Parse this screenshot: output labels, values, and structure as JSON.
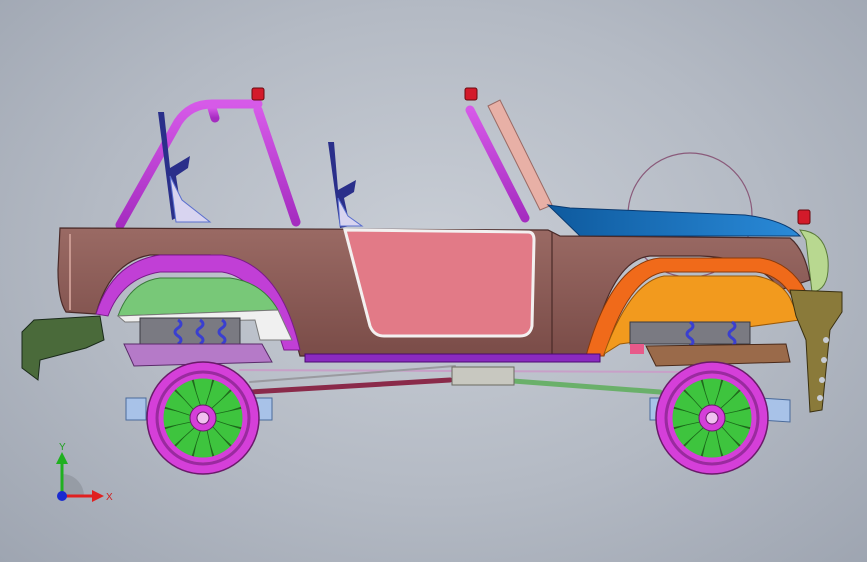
{
  "viewport": {
    "background_top": "#c9ced6",
    "background_bottom": "#9ea5b1"
  },
  "model": {
    "parts": [
      {
        "name": "body-panel",
        "color": "#8a5a55"
      },
      {
        "name": "door-panel",
        "color": "#e27a87"
      },
      {
        "name": "roll-cage",
        "color": "#c13fd6"
      },
      {
        "name": "hood",
        "color": "#1a6fb8"
      },
      {
        "name": "front-fender-liner",
        "color": "#f29a1e"
      },
      {
        "name": "rear-fender-liner",
        "color": "#78c878"
      },
      {
        "name": "wheel",
        "color": "#d53fd9"
      },
      {
        "name": "wheel-spokes",
        "color": "#3ec43e"
      },
      {
        "name": "coil-spring",
        "color": "#3a3fd0"
      },
      {
        "name": "front-bumper",
        "color": "#8a7a3a"
      },
      {
        "name": "rear-bumper",
        "color": "#4a6a3a"
      },
      {
        "name": "bracket",
        "color": "#a8c2e8"
      },
      {
        "name": "seat",
        "color": "#5a6fcf"
      }
    ]
  },
  "triad": {
    "x_label": "X",
    "y_label": "Y",
    "x_color": "#e02020",
    "y_color": "#20b020",
    "origin_color": "#1a2ad0"
  }
}
